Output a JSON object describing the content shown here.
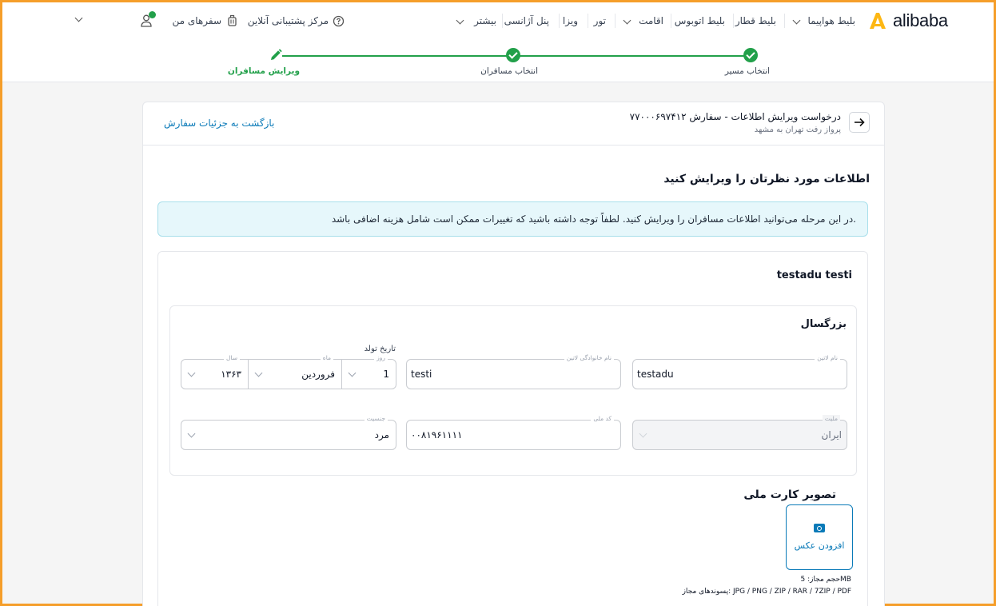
{
  "header": {
    "logo_text": "alibaba",
    "nav": [
      {
        "label": "بلیط هواپیما",
        "dropdown": true
      },
      {
        "label": "بلیط قطار"
      },
      {
        "label": "بلیط اتوبوس"
      },
      {
        "label": "اقامت",
        "dropdown": true
      },
      {
        "label": "تور"
      },
      {
        "label": "ویزا"
      },
      {
        "label": "پنل آژانسی"
      },
      {
        "label": "بیشتر",
        "dropdown": true
      }
    ],
    "support_label": "مرکز پشتیبانی آنلاین",
    "trips_label": "سفرهای من"
  },
  "stepper": {
    "steps": [
      {
        "label": "انتخاب مسیر",
        "state": "done"
      },
      {
        "label": "انتخاب مسافران",
        "state": "done"
      },
      {
        "label": "ویرایش مسافران",
        "state": "current"
      }
    ]
  },
  "order": {
    "title": "درخواست ویرایش اطلاعات - سفارش ۷۷۰۰۰۶۹۷۴۱۲",
    "subtitle": "پرواز رفت تهران به مشهد",
    "back_link": "بازگشت به جزئیات سفارش"
  },
  "main": {
    "section_title": "اطلاعات مورد نظرتان را ویرایش کنید",
    "notice": "در این مرحله می‌توانید اطلاعات مسافران را ویرایش کنید. لطفاً توجه داشته باشید که تغییرات ممکن است شامل هزینه اضافی باشد."
  },
  "passenger": {
    "name": "testadu testi",
    "type": "بزرگسال",
    "fields": {
      "first_name_label": "نام لاتین",
      "first_name": "testadu",
      "last_name_label": "نام خانوادگی لاتین",
      "last_name": "testi",
      "dob_title": "تاریخ تولد",
      "day_label": "روز",
      "day": "1",
      "month_label": "ماه",
      "month": "فروردین",
      "year_label": "سال",
      "year": "۱۳۶۳",
      "nationality_label": "ملیت",
      "nationality": "ایران",
      "national_code_label": "کد ملی",
      "national_code": "۰۰۸۱۹۶۱۱۱۱",
      "gender_label": "جنسیت",
      "gender": "مرد"
    },
    "national_card": {
      "title": "تصویر کارت ملی",
      "upload_label": "افزودن عکس",
      "size_note": "حجم مجاز: 5MB",
      "formats_note": "پسوندهای مجاز: JPG / PNG / ZIP / RAR / 7ZIP / PDF"
    }
  },
  "colors": {
    "accent": "#0a7ab8",
    "success": "#22a04a",
    "brand": "#fdb713",
    "frame": "#f59e2a"
  }
}
